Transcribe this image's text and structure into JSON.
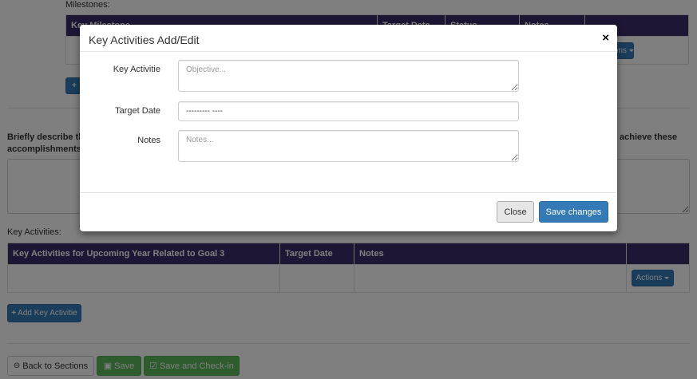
{
  "background": {
    "milestones_label": "Milestones:",
    "milestones_table_headers": [
      "Key Milestone",
      "Target Date",
      "Status",
      "Notes",
      ""
    ],
    "milestones_actions_label": "Actions",
    "add_milestone_label": "+",
    "describe_text_line1": "Briefly describe the",
    "describe_text_line1_right": "achieve these",
    "describe_text_line2": "accomplishments.",
    "key_activities_label": "Key Activities:",
    "key_activities_headers": [
      "Key Activities for Upcoming Year Related to Goal 3",
      "Target Date",
      "Notes",
      ""
    ],
    "key_activities_actions_label": "Actions",
    "add_key_activity_label": "Add Key Activitie",
    "back_label": "Back to Sections",
    "save_label": "Save",
    "save_checkin_label": "Save and Check-in"
  },
  "modal": {
    "title": "Key Activities Add/Edit",
    "close_glyph": "×",
    "fields": {
      "key_activity_label": "Key Activitie",
      "key_activity_placeholder": "Objective...",
      "target_date_label": "Target Date",
      "target_date_value": "--------- ----",
      "notes_label": "Notes",
      "notes_placeholder": "Notes..."
    },
    "close_button": "Close",
    "save_button": "Save changes"
  },
  "icons": {
    "plus": "plus-icon",
    "back": "arrow-circle-left-icon",
    "save": "floppy-disk-icon",
    "checkin": "check-square-icon",
    "close": "close-icon"
  },
  "colors": {
    "table_header": "#3d2d6b",
    "primary": "#337ab7",
    "success": "#5cb85c"
  }
}
